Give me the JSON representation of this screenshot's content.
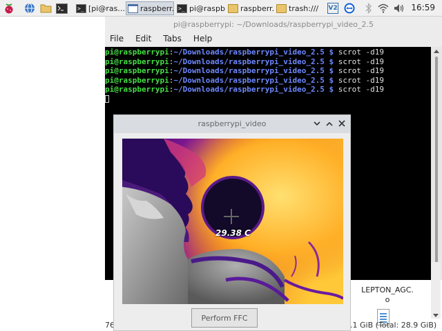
{
  "taskbar": {
    "icons": [
      "raspberry-pi-menu-icon",
      "globe-icon",
      "folder-icon",
      "terminal-icon"
    ],
    "tasks": [
      {
        "label": "[pi@ras...",
        "icon": "terminal-icon"
      },
      {
        "label": "raspberr...",
        "icon": "window-icon"
      },
      {
        "label": "pi@raspb...",
        "icon": "terminal-icon"
      },
      {
        "label": "raspberr...",
        "icon": "folder-icon"
      },
      {
        "label": "trash:///",
        "icon": "folder-icon"
      }
    ],
    "tray_icons": [
      "vnc-icon",
      "teamviewer-icon",
      "bluetooth-icon",
      "wifi-icon",
      "volume-icon"
    ],
    "vnc_label": "V2",
    "clock": "16:59"
  },
  "terminal": {
    "title": "pi@raspberrypi: ~/Downloads/raspberrypi_video_2.5",
    "menu": [
      "File",
      "Edit",
      "Tabs",
      "Help"
    ],
    "lines": [
      {
        "user": "pi@raspberrypi",
        "sep": ":",
        "path": "~/Downloads/raspberrypi_video_2.5 $",
        "cmd": " scrot -d19"
      },
      {
        "user": "pi@raspberrypi",
        "sep": ":",
        "path": "~/Downloads/raspberrypi_video_2.5 $",
        "cmd": " scrot -d19"
      },
      {
        "user": "pi@raspberrypi",
        "sep": ":",
        "path": "~/Downloads/raspberrypi_video_2.5 $",
        "cmd": " scrot -d19"
      },
      {
        "user": "pi@raspberrypi",
        "sep": ":",
        "path": "~/Downloads/raspberrypi_video_2.5 $",
        "cmd": " scrot -d19"
      },
      {
        "user": "pi@raspberrypi",
        "sep": ":",
        "path": "~/Downloads/raspberrypi_video_2.5 $",
        "cmd": " scrot -d19"
      }
    ]
  },
  "file_manager": {
    "file_name_line1": "LEPTON_AGC.",
    "file_name_line2": "o",
    "status_left": "76",
    "status_right": ".1 GiB (Total: 28.9 GiB)"
  },
  "video_window": {
    "title": "raspberrypi_video",
    "temperature": "29.38 C",
    "ffc_button": "Perform FFC"
  },
  "colors": {
    "prompt_user": "#44e044",
    "prompt_path": "#6e88ff",
    "terminal_bg": "#000000"
  }
}
